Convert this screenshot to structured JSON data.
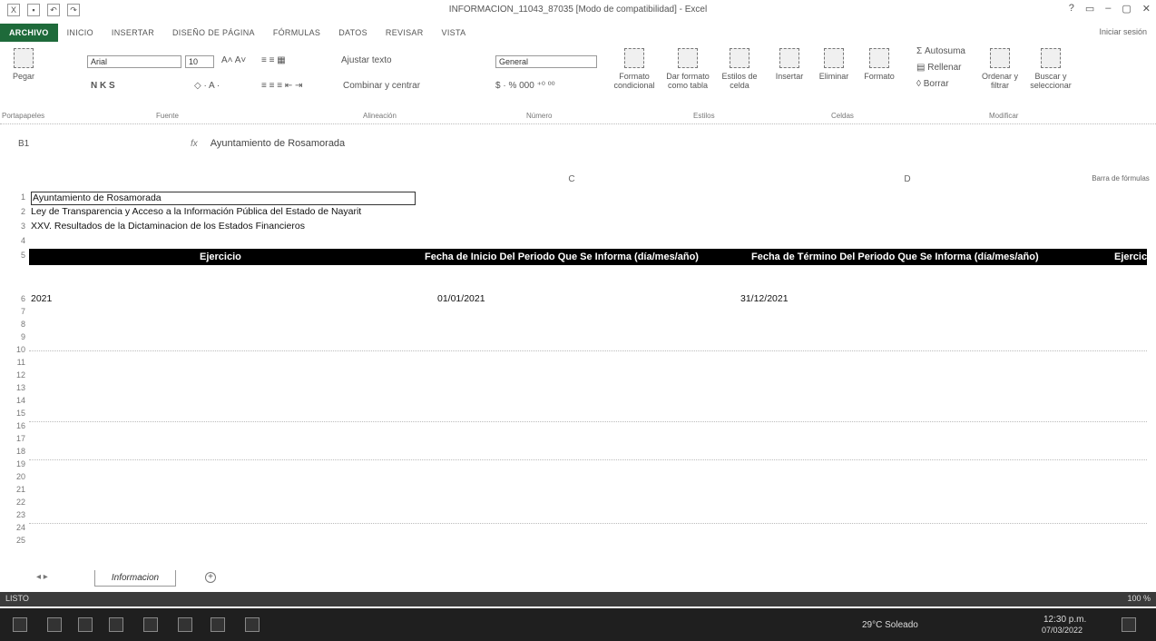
{
  "window": {
    "title": "INFORMACION_11043_87035 [Modo de compatibilidad] - Excel",
    "controls": [
      "?",
      "▭",
      "–",
      "▢",
      "✕"
    ]
  },
  "tabs": [
    "ARCHIVO",
    "INICIO",
    "INSERTAR",
    "DISEÑO DE PÁGINA",
    "FÓRMULAS",
    "DATOS",
    "REVISAR",
    "VISTA"
  ],
  "signin": "Iniciar sesión",
  "ribbon": {
    "paste": "Pegar",
    "font_name": "Arial",
    "font_size": "10",
    "font_buttons": "N  K  S",
    "wrap_text": "Ajustar texto",
    "merge_center": "Combinar y centrar",
    "number_format": "General",
    "cond_format": "Formato condicional",
    "format_table": "Dar formato como tabla",
    "cell_styles": "Estilos de celda",
    "insert": "Insertar",
    "delete": "Eliminar",
    "format": "Formato",
    "autosum": "Autosuma",
    "fill": "Rellenar",
    "clear": "Borrar",
    "sort_filter": "Ordenar y filtrar",
    "find_select": "Buscar y seleccionar",
    "groups": [
      "Portapapeles",
      "Fuente",
      "Alineación",
      "Número",
      "Estilos",
      "Celdas",
      "Modificar"
    ]
  },
  "formula_bar": {
    "name_box": "B1",
    "fx": "fx",
    "content": "Ayuntamiento de Rosamorada"
  },
  "columns": [
    "C",
    "D"
  ],
  "extra_label": "Barra de fórmulas",
  "rows": [
    "1",
    "2",
    "3",
    "4",
    "5",
    "6",
    "7",
    "8",
    "9",
    "10",
    "11",
    "12",
    "13",
    "14",
    "15",
    "16",
    "17",
    "18",
    "19",
    "20",
    "21",
    "22",
    "23",
    "24",
    "25"
  ],
  "cells": {
    "r1": "Ayuntamiento de Rosamorada",
    "r2": "Ley de Transparencia y Acceso a la Información Pública del Estado de Nayarit",
    "r3": "XXV. Resultados de la Dictaminacion de los Estados Financieros",
    "headers": [
      "Ejercicio",
      "Fecha de Inicio Del Periodo Que Se Informa (día/mes/año)",
      "Fecha de Término Del Periodo Que Se Informa (día/mes/año)",
      "Ejercici"
    ],
    "r6": [
      "2021",
      "01/01/2021",
      "31/12/2021"
    ]
  },
  "sheet": {
    "tab": "Informacion",
    "add": "+"
  },
  "status": {
    "left": "LISTO",
    "zoom": "100 %"
  },
  "taskbar": {
    "weather": "29°C Soleado",
    "time": "12:30 p.m.",
    "date": "07/03/2022"
  }
}
